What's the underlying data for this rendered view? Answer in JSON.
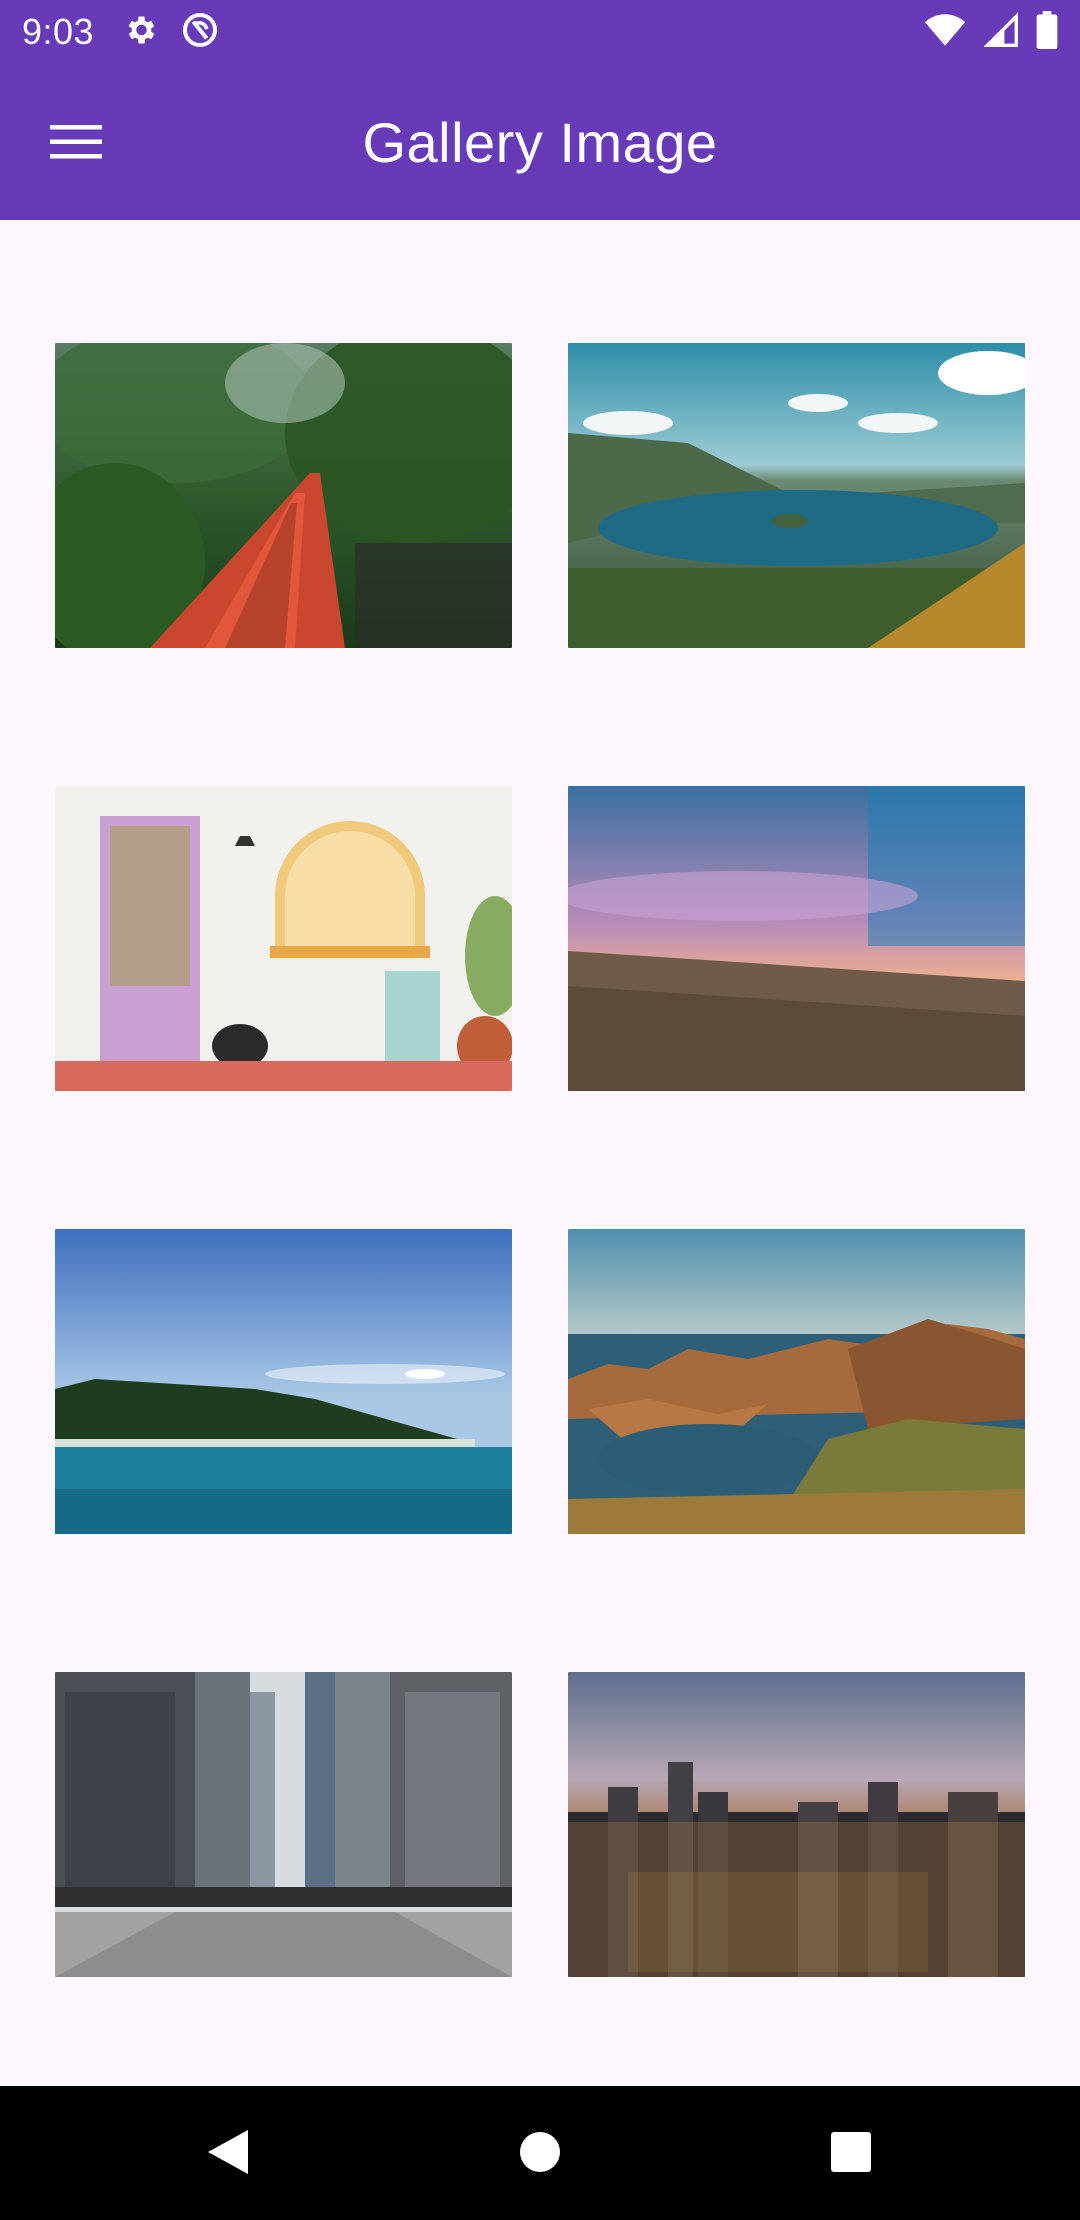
{
  "status_bar": {
    "time": "9:03",
    "left_icons": [
      "settings-icon",
      "sync-icon"
    ],
    "right_icons": [
      "wifi-icon",
      "signal-icon",
      "battery-icon"
    ]
  },
  "app_bar": {
    "title": "Gallery Image",
    "menu_icon": "hamburger-menu-icon",
    "color": "#673ab7"
  },
  "gallery": {
    "images": [
      {
        "subject": "red wooden bridge in forest"
      },
      {
        "subject": "lake with forested shores"
      },
      {
        "subject": "white house with pink door"
      },
      {
        "subject": "sunset over grassland"
      },
      {
        "subject": "tropical island and sea"
      },
      {
        "subject": "coastal hills and bays"
      },
      {
        "subject": "city street between skyscrapers"
      },
      {
        "subject": "city skyline at dusk"
      }
    ]
  },
  "nav_bar": {
    "buttons": [
      "back-icon",
      "home-icon",
      "recents-icon"
    ]
  },
  "colors": {
    "primary": "#673ab7",
    "background": "#fef7ff",
    "nav": "#000000"
  }
}
